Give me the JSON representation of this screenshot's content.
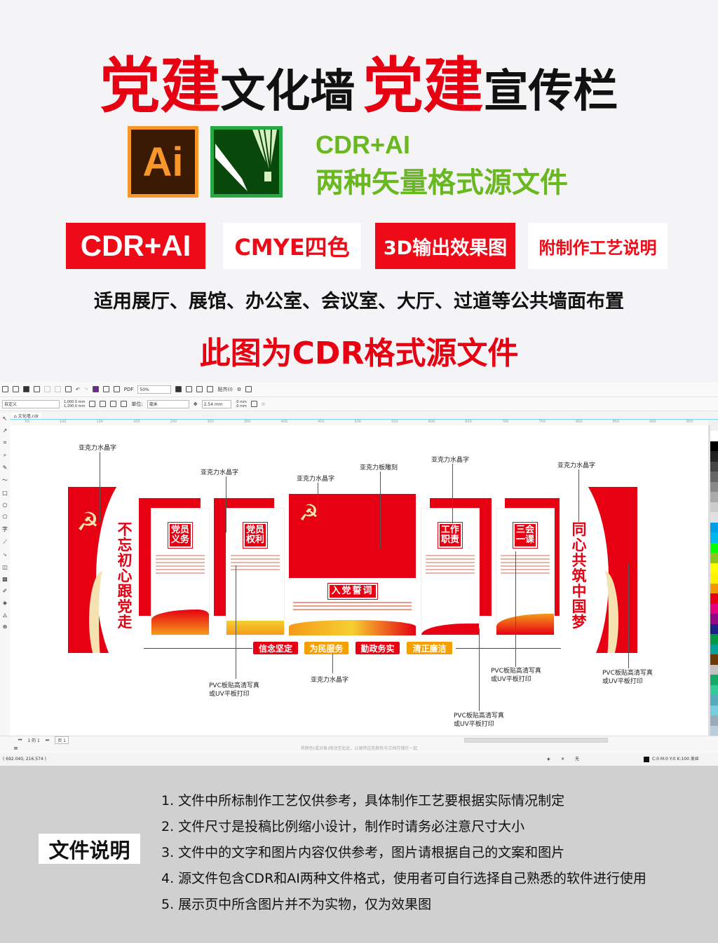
{
  "header": {
    "t1_red": "党建",
    "t1_black": "文化墙",
    "t2_red": "党建",
    "t2_black": "宣传栏"
  },
  "icons": {
    "ai_label": "Ai",
    "ai_icon": "illustrator-icon",
    "cdr_icon": "coreldraw-icon"
  },
  "formats": {
    "line1": "CDR+AI",
    "line2": "两种矢量格式源文件",
    "color": "#6ab820"
  },
  "badges": [
    {
      "label": "CDR+AI",
      "style": "red"
    },
    {
      "label": "CMYE四色",
      "style": "white"
    },
    {
      "label": "3D输出效果图",
      "style": "red"
    },
    {
      "label": "附制作工艺说明",
      "style": "white"
    }
  ],
  "usage": "适用展厅、展馆、办公室、会议室、大厅、过道等公共墙面布置",
  "source_note": "此图为CDR格式源文件",
  "colors": {
    "red": "#e60012",
    "orange": "#f5a000",
    "green": "#6ab820"
  },
  "corel": {
    "zoom": "50%",
    "snap": "贴齐(I)",
    "page_size_preset": "自定义",
    "width": "1,000.0 mm",
    "height": "1,200.0 mm",
    "units_label": "单位:",
    "units": "毫米",
    "nudge": "2.54 mm",
    "dup_x": ".0 mm",
    "dup_y": ".0 mm",
    "doc_tab": "文化墙.cdr",
    "ruler": [
      "50",
      "100",
      "150",
      "200",
      "250",
      "300",
      "350",
      "400",
      "450",
      "500",
      "550",
      "600",
      "650",
      "700",
      "750",
      "800",
      "850",
      "900",
      "950"
    ],
    "page_nav": "1 的 1",
    "page_tab": "页 1",
    "hint": "将颜色(或对象)拖动至此处，以便将这些颜色与文档存储在一起",
    "coords": "( 692.040, 216.574 )",
    "fill_none": "无",
    "outline_info": "C:0 M:0 Y:0 K:100 发丝"
  },
  "design": {
    "left_slogan": "不忘初心跟党走",
    "right_slogan": "同心共筑中国梦",
    "panels": [
      "党员义务",
      "党员权利",
      "工作职责",
      "三会一课"
    ],
    "oath_title": "入党誓词",
    "slogans": [
      "信念坚定",
      "为民服务",
      "勤政务实",
      "清正廉洁"
    ],
    "labels": {
      "acrylic_crystal": "亚克力水晶字",
      "acrylic_carve": "亚克力板雕刻",
      "pvc1": "PVC板贴高清写真",
      "pvc2": "或UV平板打印"
    }
  },
  "notes_section": {
    "title": "文件说明",
    "items": [
      "1. 文件中所标制作工艺仅供参考，具体制作工艺要根据实际情况制定",
      "2. 文件尺寸是投稿比例缩小设计，制作时请务必注意尺寸大小",
      "3. 文件中的文字和图片内容仅供参考，图片请根据自己的文案和图片",
      "4. 源文件包含CDR和AI两种文件格式，使用者可自行选择自己熟悉的软件进行使用",
      "5. 展示页中所含图片并不为实物，仅为效果图"
    ]
  }
}
